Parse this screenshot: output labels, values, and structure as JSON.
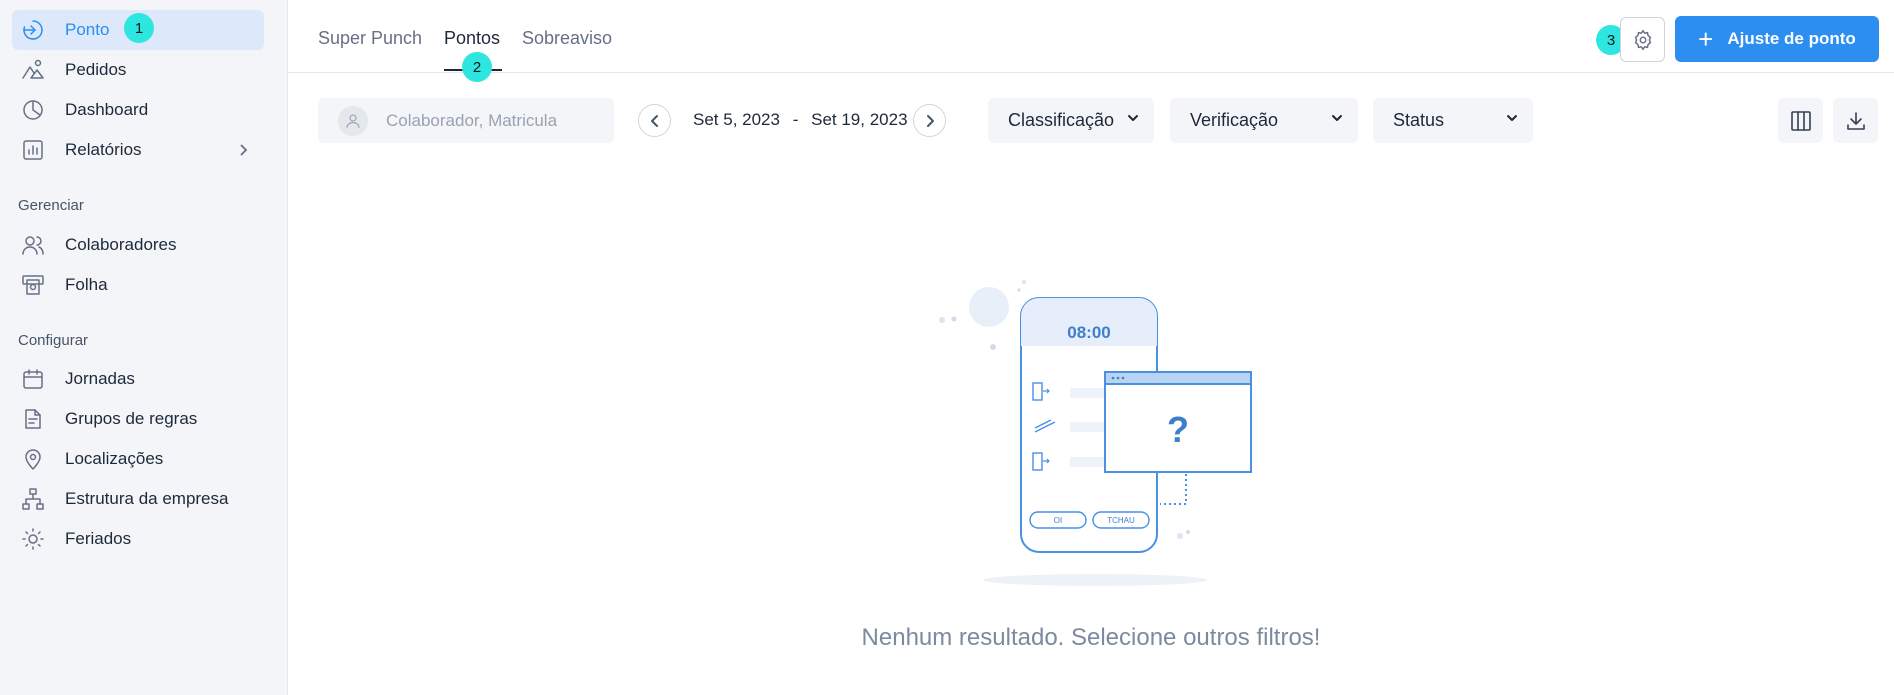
{
  "sidebar": {
    "items_top": [
      {
        "label": "Ponto",
        "icon": "login-arrow-icon",
        "active": true
      },
      {
        "label": "Pedidos",
        "icon": "mountain-shapes-icon"
      },
      {
        "label": "Dashboard",
        "icon": "pie-chart-icon"
      },
      {
        "label": "Relatórios",
        "icon": "bar-chart-icon"
      }
    ],
    "section_manage": "Gerenciar",
    "items_manage": [
      {
        "label": "Colaboradores",
        "icon": "users-icon"
      },
      {
        "label": "Folha",
        "icon": "payroll-icon"
      }
    ],
    "section_config": "Configurar",
    "items_config": [
      {
        "label": "Jornadas",
        "icon": "calendar-icon"
      },
      {
        "label": "Grupos de regras",
        "icon": "document-rules-icon"
      },
      {
        "label": "Localizações",
        "icon": "location-pin-icon"
      },
      {
        "label": "Estrutura da empresa",
        "icon": "org-structure-icon"
      },
      {
        "label": "Feriados",
        "icon": "sun-icon"
      }
    ]
  },
  "badges": {
    "b1": "1",
    "b2": "2",
    "b3": "3"
  },
  "tabs": [
    {
      "label": "Super Punch"
    },
    {
      "label": "Pontos",
      "active": true
    },
    {
      "label": "Sobreaviso"
    }
  ],
  "header": {
    "primary_button": "Ajuste de ponto",
    "settings_icon": "gear-icon"
  },
  "filters": {
    "search_placeholder": "Colaborador, Matricula",
    "date_start": "Set 5, 2023",
    "date_separator": "-",
    "date_end": "Set 19, 2023",
    "classification": "Classificação",
    "verification": "Verificação",
    "status": "Status"
  },
  "empty_state": {
    "message": "Nenhum resultado. Selecione outros filtros!",
    "phone_time": "08:00",
    "button_hi": "OI",
    "button_bye": "TCHAU",
    "question_mark": "?"
  },
  "colors": {
    "accent": "#2b8ef0",
    "badge": "#2ee6e0",
    "sidebar_bg": "#f4f5f9",
    "active_bg": "#dde9fb"
  }
}
